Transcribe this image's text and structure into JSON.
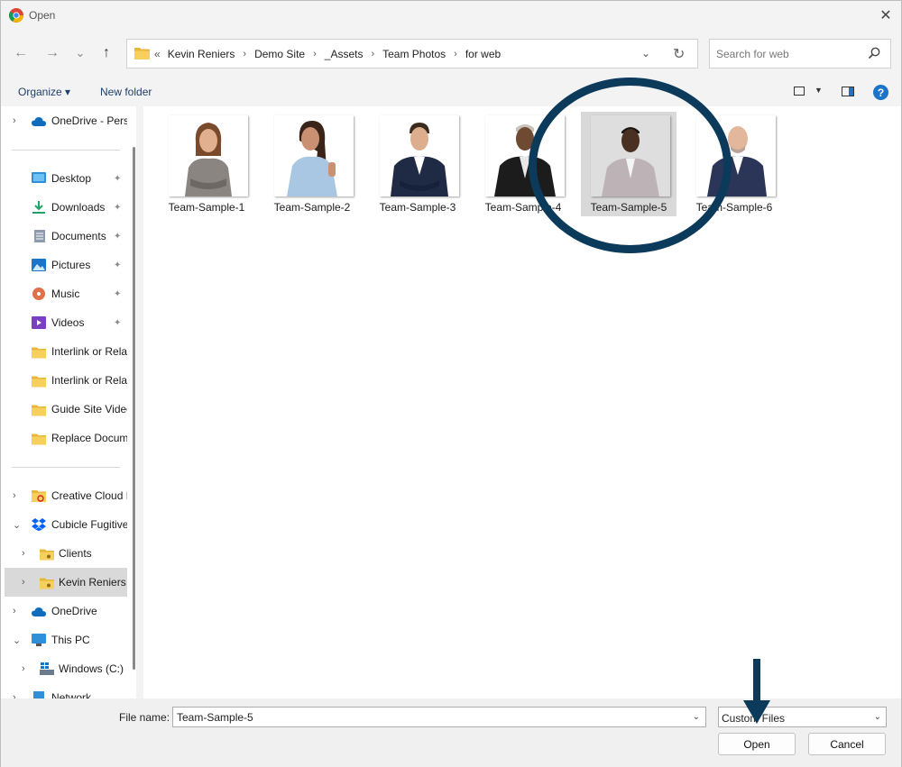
{
  "window": {
    "title": "Open",
    "close_glyph": "✕"
  },
  "nav": {
    "back_glyph": "←",
    "forward_glyph": "→",
    "recent_glyph": "⌄",
    "up_glyph": "↑",
    "overflow_glyph": "«",
    "breadcrumbs": [
      "Kevin Reniers",
      "Demo Site",
      "_Assets",
      "Team Photos",
      "for web"
    ],
    "chevron_glyph": "⌄",
    "refresh_glyph": "↻",
    "search_placeholder": "Search for web"
  },
  "commands": {
    "organize": "Organize ▾",
    "new_folder": "New folder",
    "view_chev": "▼",
    "help": "?"
  },
  "sidebar": {
    "onedrive_personal": "OneDrive - Perso",
    "desktop": "Desktop",
    "downloads": "Downloads",
    "documents": "Documents",
    "pictures": "Pictures",
    "music": "Music",
    "videos": "Videos",
    "interlink1": "Interlink or Relat",
    "interlink2": "Interlink or Relat",
    "guide": "Guide Site Video",
    "replace": "Replace Docum",
    "creative_cloud": "Creative Cloud F",
    "cubicle": "Cubicle Fugitive",
    "clients": "Clients",
    "kevin": "Kevin Reniers",
    "onedrive": "OneDrive",
    "this_pc": "This PC",
    "windows_c": "Windows (C:)",
    "network": "Network",
    "chev_right": "›",
    "chev_down": "⌄",
    "pin": "📌"
  },
  "files": [
    {
      "name": "Team-Sample-1"
    },
    {
      "name": "Team-Sample-2"
    },
    {
      "name": "Team-Sample-3"
    },
    {
      "name": "Team-Sample-4"
    },
    {
      "name": "Team-Sample-5"
    },
    {
      "name": "Team-Sample-6"
    }
  ],
  "bottom": {
    "file_name_label": "File name:",
    "file_name_value": "Team-Sample-5",
    "file_type": "Custom Files",
    "open": "Open",
    "cancel": "Cancel",
    "dd_glyph": "⌄"
  },
  "colors": {
    "accent": "#1c74c8",
    "annotation": "#0c3a5b",
    "folder": "#f4c542"
  }
}
